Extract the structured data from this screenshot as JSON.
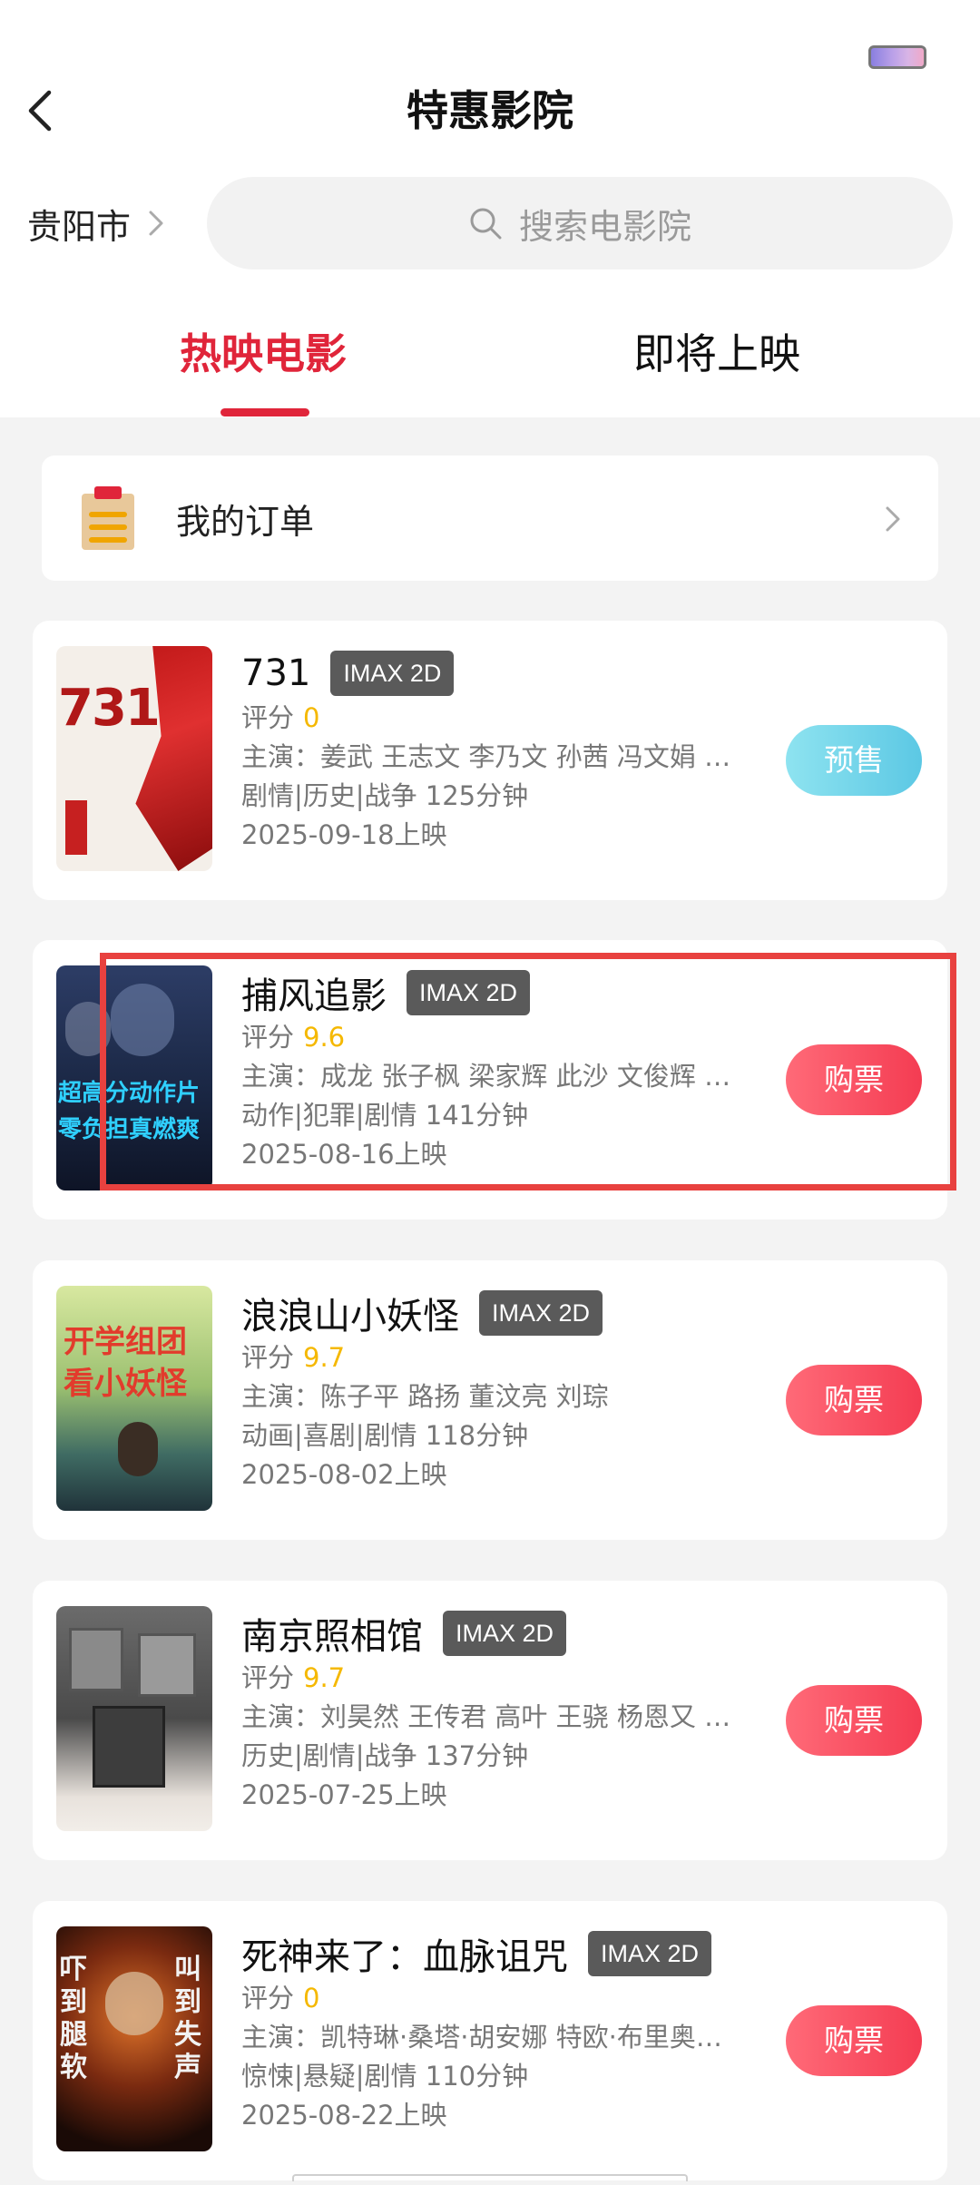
{
  "header": {
    "title": "特惠影院",
    "back_icon": "chevron-left-icon"
  },
  "location": {
    "city": "贵阳市"
  },
  "search": {
    "placeholder": "搜索电影院"
  },
  "tabs": [
    {
      "label": "热映电影",
      "active": true
    },
    {
      "label": "即将上映",
      "active": false
    }
  ],
  "orders": {
    "label": "我的订单"
  },
  "movies": [
    {
      "title": "731",
      "format": "IMAX 2D",
      "score_label": "评分",
      "score": "0",
      "cast": "主演：姜武 王志文 李乃文 孙茜 冯文娟 …",
      "genre_duration": "剧情|历史|战争  125分钟",
      "release": "2025-09-18上映",
      "action": "预售",
      "poster_text": "731"
    },
    {
      "title": "捕风追影",
      "format": "IMAX 2D",
      "score_label": "评分",
      "score": "9.6",
      "cast": "主演：成龙 张子枫 梁家辉 此沙 文俊辉 …",
      "genre_duration": "动作|犯罪|剧情  141分钟",
      "release": "2025-08-16上映",
      "action": "购票",
      "poster_text_1": "超高分动作片",
      "poster_text_2": "零负担真燃爽"
    },
    {
      "title": "浪浪山小妖怪",
      "format": "IMAX 2D",
      "score_label": "评分",
      "score": "9.7",
      "cast": "主演：陈子平 路扬 董汶亮 刘琮",
      "genre_duration": "动画|喜剧|剧情  118分钟",
      "release": "2025-08-02上映",
      "action": "购票",
      "poster_text_1": "开学组团",
      "poster_text_2": "看小妖怪"
    },
    {
      "title": "南京照相馆",
      "format": "IMAX 2D",
      "score_label": "评分",
      "score": "9.7",
      "cast": "主演：刘昊然 王传君 高叶 王骁 杨恩又 …",
      "genre_duration": "历史|剧情|战争  137分钟",
      "release": "2025-07-25上映",
      "action": "购票"
    },
    {
      "title": "死神来了：血脉诅咒",
      "format": "IMAX 2D",
      "score_label": "评分",
      "score": "0",
      "cast": "主演：凯特琳·桑塔·胡安娜 特欧·布里奥…",
      "genre_duration": "惊悚|悬疑|剧情  110分钟",
      "release": "2025-08-22上映",
      "action": "购票",
      "poster_text_1": "吓到腿软",
      "poster_text_2": "叫到失声"
    }
  ],
  "colors": {
    "accent": "#e0253a",
    "score": "#f5b800",
    "highlight": "#e8413f"
  }
}
